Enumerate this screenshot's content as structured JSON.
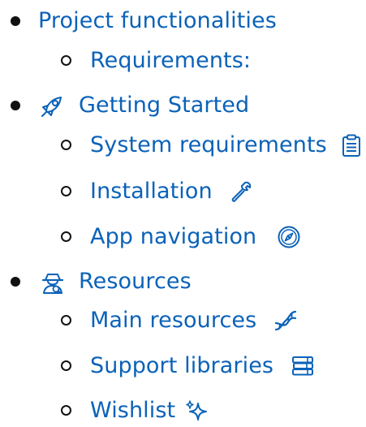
{
  "toc": {
    "items": [
      {
        "label": "Project functionalities",
        "icon": null,
        "children": [
          {
            "label": "Requirements:",
            "icon": null
          }
        ]
      },
      {
        "label": "Getting Started",
        "icon": "rocket-icon",
        "children": [
          {
            "label": "System requirements",
            "icon": "clipboard-icon"
          },
          {
            "label": "Installation",
            "icon": "wrench-icon"
          },
          {
            "label": "App navigation",
            "icon": "compass-icon"
          }
        ]
      },
      {
        "label": "Resources",
        "icon": "detective-icon",
        "children": [
          {
            "label": "Main resources",
            "icon": "dna-icon"
          },
          {
            "label": "Support libraries",
            "icon": "books-icon"
          },
          {
            "label": "Wishlist",
            "icon": "sparkles-icon"
          }
        ]
      }
    ]
  },
  "colors": {
    "link": "#0b62b8",
    "bullet": "#111111"
  }
}
